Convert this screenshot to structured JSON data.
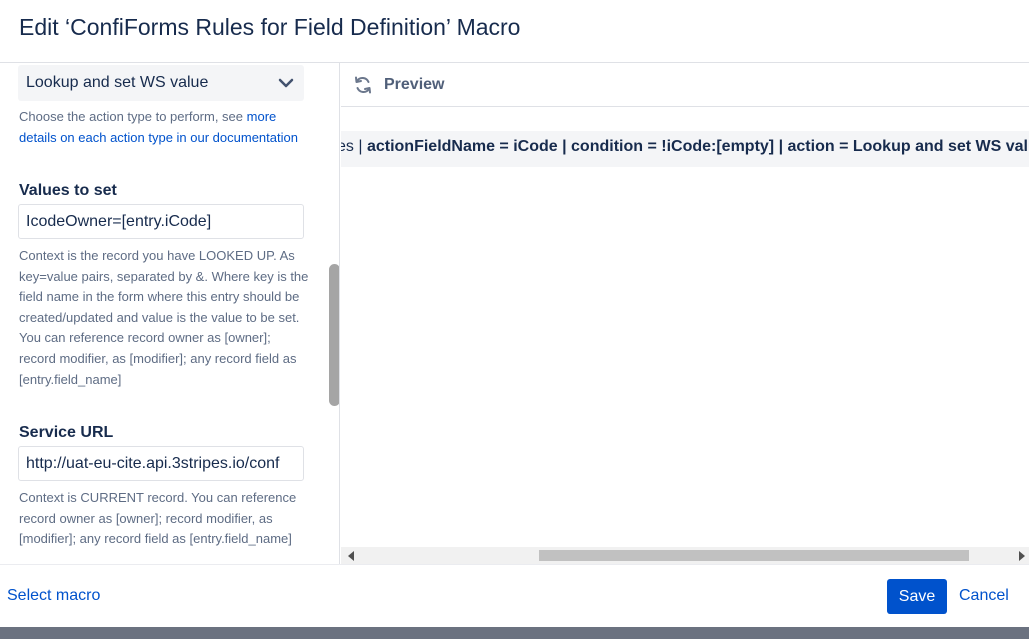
{
  "dialog": {
    "title": "Edit ‘ConfiForms Rules for Field Definition’ Macro"
  },
  "settings": {
    "action_type": {
      "selected": "Lookup and set WS value",
      "help_prefix": "Choose the action type to perform, see",
      "help_link": "more details on each action type in our documentation"
    },
    "values_to_set": {
      "label": "Values to set",
      "value": "IcodeOwner=[entry.iCode]",
      "help": "Context is the record you have LOOKED UP. As key=value pairs, separated by &. Where key is the field name in the form where this entry should be created/updated and value is the value to be set. You can reference record owner as [owner]; record modifier, as [modifier]; any record field as [entry.field_name]"
    },
    "service_url": {
      "label": "Service URL",
      "value": "http://uat-eu-cite.api.3stripes.io/conf",
      "help": "Context is CURRENT record. You can reference record owner as [owner]; record modifier, as [modifier]; any record field as [entry.field_name]"
    }
  },
  "preview": {
    "label": "Preview",
    "prefix": "es | ",
    "content": "actionFieldName = iCode | condition = !iCode:[empty] | action = Lookup and set WS value"
  },
  "footer": {
    "select_macro": "Select macro",
    "save": "Save",
    "cancel": "Cancel"
  },
  "colors": {
    "primary": "#0052cc",
    "text": "#172b4d",
    "subtle_text": "#5e6c84",
    "panel_bg": "#f4f5f7"
  },
  "icons": {
    "chevron": "chevron-down-icon",
    "refresh": "refresh-icon",
    "scroll_left": "arrow-left-icon",
    "scroll_right": "arrow-right-icon"
  }
}
